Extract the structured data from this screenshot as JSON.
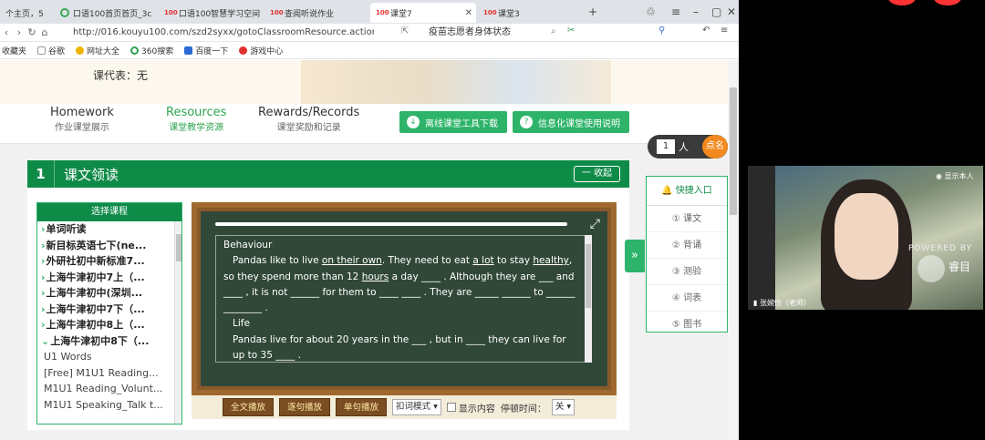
{
  "browser": {
    "tabs": [
      {
        "label": "个主页，5"
      },
      {
        "label": "口语100首页首页_3c"
      },
      {
        "label": "口语100智慧学习空间"
      },
      {
        "label": "查阅听说作业"
      },
      {
        "label": "课堂7"
      },
      {
        "label": "课堂3"
      }
    ],
    "url": "http://016.kouyu100.com/szd2syxx/gotoClassroomResource.action?orgId",
    "search_text": "疫苗志愿者身体状态",
    "bookmarks": [
      "收藏夹",
      "谷歌",
      "网址大全",
      "360搜索",
      "百度一下",
      "游戏中心"
    ]
  },
  "page": {
    "representative": "课代表：无",
    "nav": [
      {
        "en": "Homework",
        "cn": "作业课堂展示"
      },
      {
        "en": "Resources",
        "cn": "课堂教学资源"
      },
      {
        "en": "Rewards/Records",
        "cn": "课堂奖励和记录"
      }
    ],
    "buttons": {
      "download": "离线课堂工具下载",
      "guide": "信息化课堂使用说明"
    },
    "section": {
      "number": "1",
      "title": "课文领读",
      "collapse": "一 收起"
    },
    "course_list": {
      "header": "选择课程",
      "items": [
        "单词听读",
        "新目标英语七下(ne...",
        "外研社初中新标准7...",
        "上海牛津初中7上（...",
        "上海牛津初中(深圳...",
        "上海牛津初中7下（...",
        "上海牛津初中8上（...",
        "上海牛津初中8下（...",
        "U1 Words",
        "[Free] M1U1 Reading...",
        "M1U1 Reading_Volunt...",
        "M1U1 Speaking_Talk t..."
      ]
    },
    "board": {
      "heading": "Behaviour",
      "p1_a": "Pandas like to live ",
      "p1_u1": "on their own",
      "p1_b": ". They need to eat ",
      "p1_u2": "a lot",
      "p1_c": " to stay ",
      "p1_u3": "healthy",
      "p1_d": ", so they spend more than 12 ",
      "p1_u4": "hours",
      "p1_e": " a day ____ . Although they are ___ and ____ , it is not ______ for them to ____ ____ . They are _____ ______ to ______ ________ .",
      "heading2": "Life",
      "p2": "Pandas live for about 20 years in the ___ , but in ____ they can live for up to 35 ____ ."
    },
    "toolbar": {
      "play_all": "全文播放",
      "play_sentence": "逐句播放",
      "single_play": "单句播放",
      "mode": "扣词模式",
      "show_content": "显示内容",
      "pause_label": "停顿时间：",
      "pause_value": "关"
    },
    "quick": {
      "header": "快捷入口",
      "items": [
        "① 课文",
        "② 背诵",
        "③ 测验",
        "④ 词表",
        "⑤ 图书"
      ]
    },
    "counter": {
      "value": "1",
      "unit": "人",
      "call": "点名"
    }
  },
  "video": {
    "badge": "显示本人",
    "powered": "POWERED BY",
    "brand": "睿目",
    "name": "张婉怡（老师）"
  }
}
